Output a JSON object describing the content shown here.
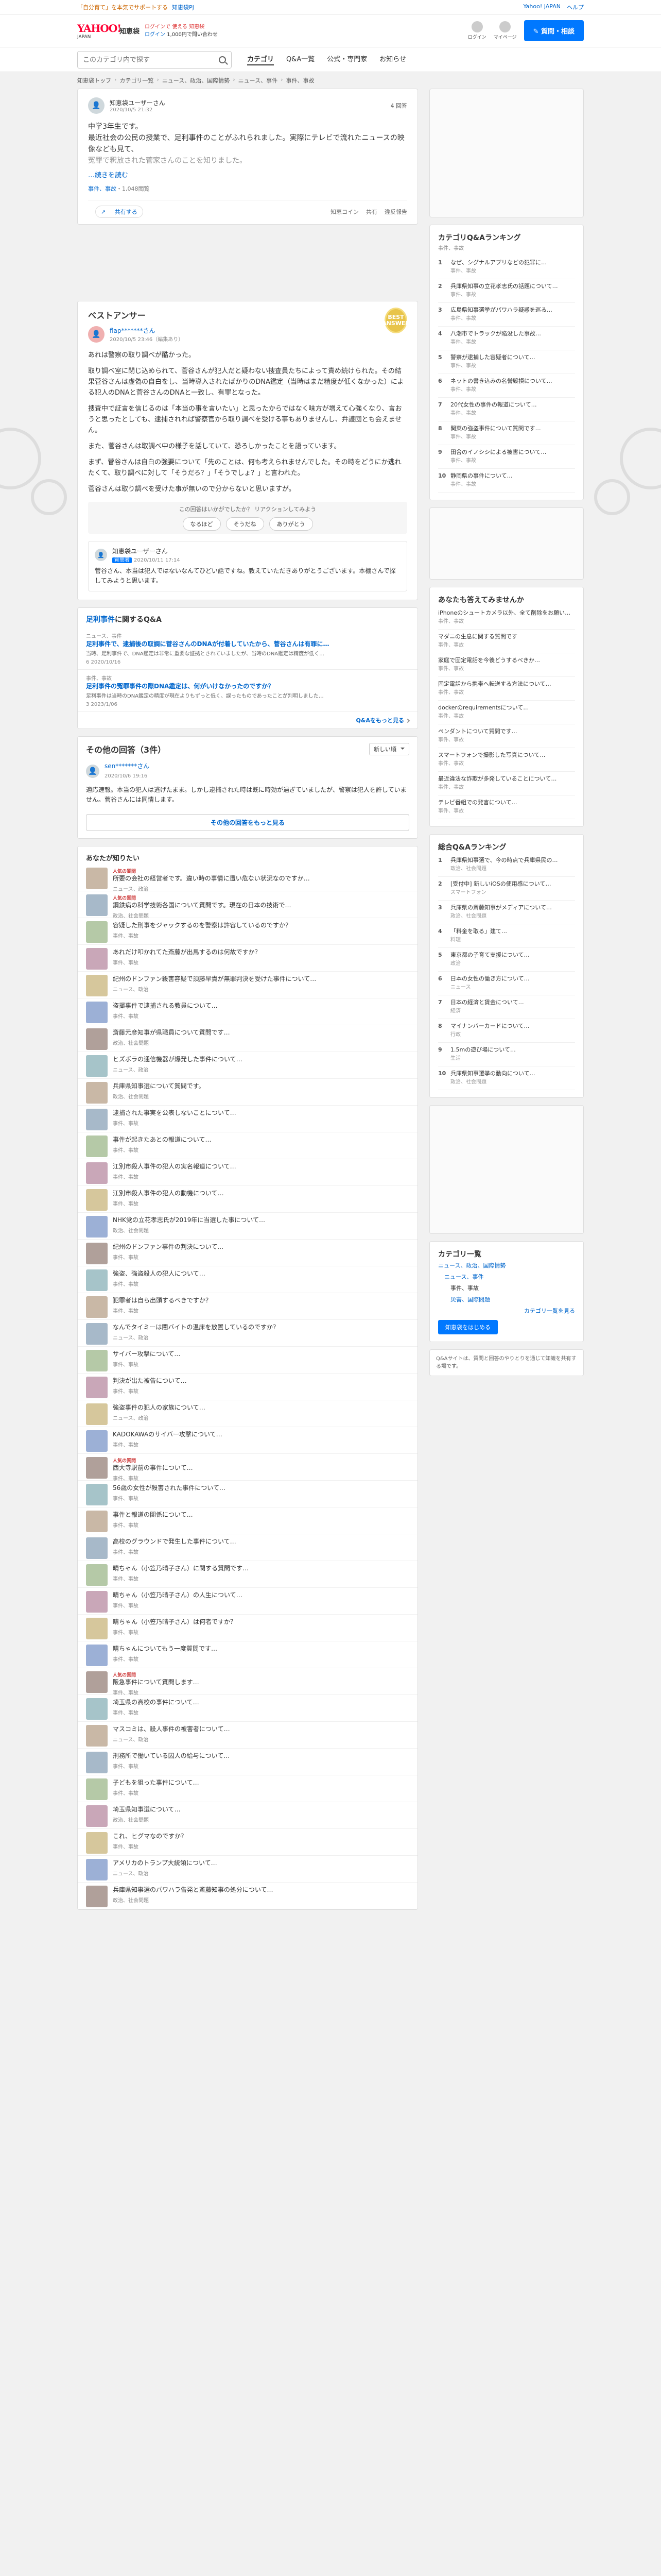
{
  "topbar": {
    "notice": "「自分育て」を本気でサポートする",
    "project": "知恵袋PJ",
    "links": [
      "Yahoo! JAPAN",
      "ヘルプ"
    ]
  },
  "header": {
    "logo": "YAHOO!",
    "logo_sub": "JAPAN",
    "service": "知恵袋",
    "line1": "ログインで 使える 知恵袋",
    "line2_prefix": "ログイン",
    "line2_suffix": "1,000円で問い合わせ",
    "icons": [
      {
        "name": "login-avatar-icon",
        "label": "ログイン"
      },
      {
        "name": "mypage-icon",
        "label": "マイページ"
      }
    ],
    "ask_button": "質問・相談"
  },
  "nav": {
    "search_placeholder": "このカテゴリ内で探す",
    "tabs": [
      "カテゴリ",
      "Q&A一覧",
      "公式・専門家",
      "お知らせ"
    ],
    "active_tab": 0
  },
  "breadcrumb": [
    "知恵袋トップ",
    "カテゴリ一覧",
    "ニュース、政治、国際情勢",
    "ニュース、事件",
    "事件、事故"
  ],
  "question": {
    "user": "知恵袋ユーザーさん",
    "date": "2020/10/5 21:32",
    "answers": "4 回答",
    "body_lines": [
      "中学3年生です。",
      "最近社会の公民の授業で、足利事件のことがふれられました。実際にテレビで流れたニュースの映像なども見て、"
    ],
    "faded": "冤罪で釈放された菅家さんのことを知りました。",
    "more": "…続きを読む",
    "meta_prefix": "事件、事故",
    "meta_views": "・1,048閲覧",
    "share": "共有する",
    "actions": [
      "知恵コイン",
      "共有",
      "違反報告"
    ]
  },
  "best_answer": {
    "title": "ベストアンサー",
    "medal": "BEST ANSWER",
    "user": "flap*******さん",
    "date": "2020/10/5 23:46（編集あり）",
    "paragraphs": [
      "あれは警察の取り調べが酷かった。",
      "取り調べ室に閉じ込められて、菅谷さんが犯人だと疑わない捜査員たちによって責め続けられた。その結果菅谷さんは虚偽の自白をし、当時導入されたばかりのDNA鑑定（当時はまだ精度が低くなかった）による犯人のDNAと菅谷さんのDNAと一致し、有罪となった。",
      "捜査中で証言を信じるのは「本当の事を言いたい」と思ったからではなく味方が増えて心強くなり、言おうと思ったとしても、逮捕されれば警察官から取り調べを受ける事もありませんし、弁護団とも会えません。",
      "また、菅谷さんは取調べ中の様子を話していて、恐ろしかったことを語っています。",
      "まず、菅谷さんは自白の強要について「先のことは、何も考えられませんでした。その時をどうにか逃れたくて、取り調べに対して「そうだろ？」「そうでしょ？」と言われた。",
      "菅谷さんは取り調べを受けた事が無いので分からないと思いますが。"
    ],
    "helpful_text": "この回答はいかがでしたか？ リアクションしてみよう",
    "helpful_buttons": [
      "なるほど",
      "そうだね",
      "ありがとう"
    ],
    "reply": {
      "user": "知恵袋ユーザーさん",
      "badge": "質問者",
      "date": "2020/10/11 17:14",
      "body": "菅谷さん、本当は犯人ではないなんてひどい話ですね。教えていただきありがとうございます。本棚さんで探してみようと思います。"
    }
  },
  "related": {
    "title_prefix": "足利事件",
    "title_suffix": "に関するQ&A",
    "items": [
      {
        "cat": "ニュース、事件",
        "q": "足利事件で、逮捕後の取調に菅谷さんのDNAが付着していたから、菅谷さんは有罪に…",
        "snippet": "当時、足利事件で、DNA鑑定は非常に重要な証拠とされていましたが、当時のDNA鑑定は精度が低く…",
        "foot": "6 2020/10/16"
      },
      {
        "cat": "事件、事故",
        "q": "足利事件の冤罪事件の際DNA鑑定は、何がいけなかったのですか？",
        "snippet": "足利事件は当時のDNA鑑定の精度が現在よりもずっと低く、誤ったものであったことが判明しました…",
        "foot": "3 2023/1/06"
      }
    ],
    "more": "Q&Aをもっと見る"
  },
  "other_answers": {
    "title": "その他の回答（3件）",
    "sort": "新しい順",
    "user": "sen*******さん",
    "date": "2020/10/6 19:16",
    "body": "適応速報。本当の犯人は逃げたまま。しかし逮捕された時は既に時効が過ぎていましたが、警察は犯人を許していません。菅谷さんには同情します。",
    "more": "その他の回答をもっと見る"
  },
  "recommended": {
    "title": "あなたが知りたい",
    "items": [
      {
        "ai": "人気の質問",
        "q": "所要の会社の経営者です。違い時の事情に遭い危ない状況なのですか…",
        "meta": "ニュース、政治"
      },
      {
        "ai": "人気の質問",
        "q": "鋼鉄病の科学技術各国について質問です。現在の日本の技術で…",
        "meta": "政治、社会問題"
      },
      {
        "ai": "",
        "q": "容疑した刑事をジャックするのを警察は許容しているのですか？",
        "meta": "事件、事故"
      },
      {
        "ai": "",
        "q": "あれだけ叩かれてた斎藤が出馬するのは何故ですか？",
        "meta": "事件、事故"
      },
      {
        "ai": "",
        "q": "紀州のドンファン殺害容疑で須藤早貴が無罪判決を受けた事件について…",
        "meta": "ニュース、政治"
      },
      {
        "ai": "",
        "q": "盗撮事件で逮捕される教員について…",
        "meta": "事件、事故"
      },
      {
        "ai": "",
        "q": "斎藤元彦知事が県職員について質問です…",
        "meta": "政治、社会問題"
      },
      {
        "ai": "",
        "q": "ヒズボラの通信機器が爆発した事件について…",
        "meta": "ニュース、政治"
      },
      {
        "ai": "",
        "q": "兵庫県知事選について質問です。",
        "meta": "政治、社会問題"
      },
      {
        "ai": "",
        "q": "逮捕された事実を公表しないことについて…",
        "meta": "事件、事故"
      },
      {
        "ai": "",
        "q": "事件が起きたあとの報道について…",
        "meta": "事件、事故"
      },
      {
        "ai": "",
        "q": "江別市殺人事件の犯人の実名報道について…",
        "meta": "事件、事故"
      },
      {
        "ai": "",
        "q": "江別市殺人事件の犯人の動機について…",
        "meta": "事件、事故"
      },
      {
        "ai": "",
        "q": "NHK党の立花孝志氏が2019年に当選した事について…",
        "meta": "政治、社会問題"
      },
      {
        "ai": "",
        "q": "紀州のドンファン事件の判決について…",
        "meta": "事件、事故"
      },
      {
        "ai": "",
        "q": "強盗、強盗殺人の犯人について…",
        "meta": "事件、事故"
      },
      {
        "ai": "",
        "q": "犯罪者は自ら出頭するべきですか？",
        "meta": "事件、事故"
      },
      {
        "ai": "",
        "q": "なんでタイミーは闇バイトの温床を放置しているのですか？",
        "meta": "ニュース、政治"
      },
      {
        "ai": "",
        "q": "サイバー攻撃について…",
        "meta": "事件、事故"
      },
      {
        "ai": "",
        "q": "判決が出た被告について…",
        "meta": "事件、事故"
      },
      {
        "ai": "",
        "q": "強盗事件の犯人の家族について…",
        "meta": "ニュース、政治"
      },
      {
        "ai": "",
        "q": "KADOKAWAのサイバー攻撃について…",
        "meta": "事件、事故"
      },
      {
        "ai": "人気の質問",
        "q": "西大寺駅前の事件について…",
        "meta": "事件、事故"
      },
      {
        "ai": "",
        "q": "56歳の女性が殺害された事件について…",
        "meta": "事件、事故"
      },
      {
        "ai": "",
        "q": "事件と報道の関係について…",
        "meta": "事件、事故"
      },
      {
        "ai": "",
        "q": "高校のグラウンドで発生した事件について…",
        "meta": "事件、事故"
      },
      {
        "ai": "",
        "q": "晴ちゃん（小笠乃晴子さん）に関する質問です…",
        "meta": "事件、事故"
      },
      {
        "ai": "",
        "q": "晴ちゃん（小笠乃晴子さん）の人生について…",
        "meta": "事件、事故"
      },
      {
        "ai": "",
        "q": "晴ちゃん（小笠乃晴子さん）は何者ですか？",
        "meta": "事件、事故"
      },
      {
        "ai": "",
        "q": "晴ちゃんについてもう一度質問です…",
        "meta": "事件、事故"
      },
      {
        "ai": "人気の質問",
        "q": "阪急事件について質問します…",
        "meta": "事件、事故"
      },
      {
        "ai": "",
        "q": "埼玉県の高校の事件について…",
        "meta": "事件、事故"
      },
      {
        "ai": "",
        "q": "マスコミは、殺人事件の被害者について…",
        "meta": "ニュース、政治"
      },
      {
        "ai": "",
        "q": "刑務所で働いている囚人の給与について…",
        "meta": "事件、事故"
      },
      {
        "ai": "",
        "q": "子どもを狙った事件について…",
        "meta": "事件、事故"
      },
      {
        "ai": "",
        "q": "埼玉県知事選について…",
        "meta": "政治、社会問題"
      },
      {
        "ai": "",
        "q": "これ、ヒグマなのですか？",
        "meta": "事件、事故"
      },
      {
        "ai": "",
        "q": "アメリカのトランプ大統領について…",
        "meta": "ニュース、政治"
      },
      {
        "ai": "",
        "q": "兵庫県知事選のパワハラ告発と斎藤知事の処分について…",
        "meta": "政治、社会問題"
      }
    ]
  },
  "sidebar": {
    "ranking1": {
      "title": "カテゴリQ&Aランキング",
      "sub": "事件、事故",
      "items": [
        {
          "t": "なぜ、シグナルアプリなどの犯罪に…",
          "s": "事件、事故"
        },
        {
          "t": "兵庫県知事の立花孝志氏の話題について…",
          "s": "事件、事故"
        },
        {
          "t": "広島県知事選挙がパワハラ疑惑を巡る…",
          "s": "事件、事故"
        },
        {
          "t": "八潮市でトラックが陥没した事故…",
          "s": "事件、事故"
        },
        {
          "t": "警察が逮捕した容疑者について…",
          "s": "事件、事故"
        },
        {
          "t": "ネットの書き込みの名誉毀損について…",
          "s": "事件、事故"
        },
        {
          "t": "20代女性の事件の報道について…",
          "s": "事件、事故"
        },
        {
          "t": "関東の強盗事件について質問です…",
          "s": "事件、事故"
        },
        {
          "t": "田舎のイノシシによる被害について…",
          "s": "事件、事故"
        },
        {
          "t": "静岡県の事件について…",
          "s": "事件、事故"
        }
      ]
    },
    "recommend": {
      "title": "あなたも答えてみませんか",
      "items": [
        {
          "t": "iPhoneのシュートカメラ以外、全て削除をお願いします",
          "s": "事件、事故"
        },
        {
          "t": "マダニの生息に関する質問です",
          "s": "事件、事故"
        },
        {
          "t": "家庭で固定電話を今後どうするべきか…",
          "s": "事件、事故"
        },
        {
          "t": "固定電話から携帯へ転送する方法について…",
          "s": "事件、事故"
        },
        {
          "t": "dockerのrequirementsについて…",
          "s": "事件、事故"
        },
        {
          "t": "ペンダントについて質問です…",
          "s": "事件、事故"
        },
        {
          "t": "スマートフォンで撮影した写真について…",
          "s": "事件、事故"
        },
        {
          "t": "最近違法な詐欺が多発していることについて…",
          "s": "事件、事故"
        },
        {
          "t": "テレビ番組での発言について…",
          "s": "事件、事故"
        }
      ]
    },
    "ranking2": {
      "title": "総合Q&Aランキング",
      "items": [
        {
          "t": "兵庫県知事選で、今の時点で兵庫県民の…",
          "s": "政治、社会問題"
        },
        {
          "t": "[受付中] 新しいiOSの使用感について…",
          "s": "スマートフォン"
        },
        {
          "t": "兵庫県の斎藤知事がメディアについて…",
          "s": "政治、社会問題"
        },
        {
          "t": "「料金を取る」建て…",
          "s": "料理"
        },
        {
          "t": "東京都の子育て支援について…",
          "s": "政治"
        },
        {
          "t": "日本の女性の働き方について…",
          "s": "ニュース"
        },
        {
          "t": "日本の経済と賃金について…",
          "s": "経済"
        },
        {
          "t": "マイナンバーカードについて…",
          "s": "行政"
        },
        {
          "t": "1.5mの遊び場について…",
          "s": "生活"
        },
        {
          "t": "兵庫県知事選挙の動向について…",
          "s": "政治、社会問題"
        }
      ]
    },
    "category": {
      "title": "カテゴリ一覧",
      "lvl1": "ニュース、政治、国際情勢",
      "lvl2": "ニュース、事件",
      "lvl3": "事件、事故",
      "lvl3b": "災害、国際問題",
      "link": "カテゴリ一覧を見る",
      "button": "知恵袋をはじめる"
    },
    "banner": "Q&Aサイトは、質問と回答のやりとりを通じて知識を共有する場です。"
  }
}
